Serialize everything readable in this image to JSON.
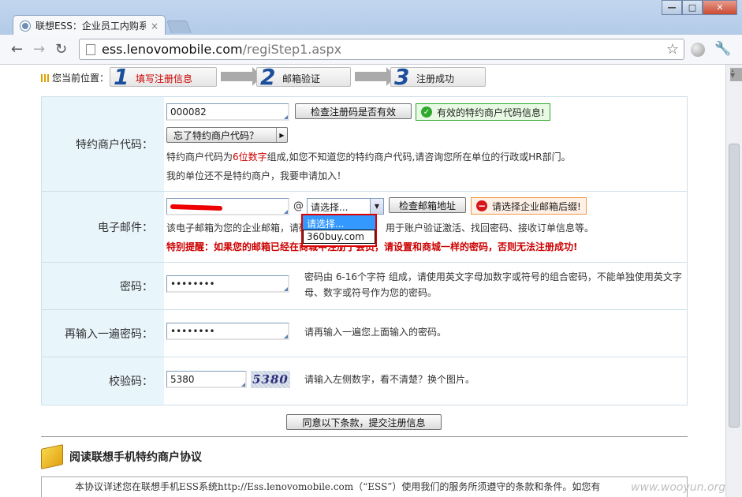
{
  "browser": {
    "tab_title": "联想ESS：企业员工内购系统",
    "tab_close": "×",
    "url_host": "ess.lenovomobile.com",
    "url_path": "/regiStep1.aspx",
    "back": "←",
    "forward": "→",
    "reload": "↻",
    "star": "☆",
    "wrench": "🔧",
    "win_min": "—",
    "win_max": "□",
    "win_close": "✕"
  },
  "breadcrumb": {
    "label": "您当前位置：",
    "steps": [
      {
        "num": "1",
        "label": "填写注册信息"
      },
      {
        "num": "2",
        "label": "邮箱验证"
      },
      {
        "num": "3",
        "label": "注册成功"
      }
    ]
  },
  "merchant": {
    "label": "特约商户代码：",
    "value": "000082",
    "check_button": "检查注册码是否有效",
    "valid_msg": "有效的特约商户代码信息!",
    "forgot_button": "忘了特约商户代码？",
    "hint_pre": "特约商户代码为",
    "hint_digits": "6位数字",
    "hint_post": "组成,如您不知道您的特约商户代码,请咨询您所在单位的行政或HR部门。",
    "apply_text": "我的单位还不是特约商户，我要申请加入！"
  },
  "email": {
    "label": "电子邮件：",
    "at": "@",
    "select_value": "请选择...",
    "options": [
      "请选择...",
      "360buy.com"
    ],
    "check_button": "检查邮箱地址",
    "error_msg": "请选择企业邮箱后缀!",
    "hint_a": "该电子邮箱为您的企业邮箱，请确",
    "hint_b": "用于账户验证激活、找回密码、接收订单信息等。",
    "warning": "特别提醒：如果您的邮箱已经在商城中注册了会员，请设置和商城一样的密码，否则无法注册成功!"
  },
  "password": {
    "label": "密码：",
    "value": "••••••••",
    "hint": "密码由 6-16个字符 组成，请使用英文字母加数字或符号的组合密码，不能单独使用英文字母、数字或符号作为您的密码。"
  },
  "password_confirm": {
    "label": "再输入一遍密码：",
    "value": "••••••••",
    "hint": "请再输入一遍您上面输入的密码。"
  },
  "captcha": {
    "label": "校验码：",
    "value": "5380",
    "image_text": "5380",
    "hint": "请输入左侧数字，看不清楚？换个图片。"
  },
  "submit_button": "同意以下条款，提交注册信息",
  "agreement": {
    "title": "阅读联想手机特约商户协议",
    "text": "本协议详述您在联想手机ESS系统http://Ess.lenovomobile.com（“ESS”）使用我们的服务所须遵守的条款和条件。如您有"
  },
  "watermark": "www.wooyun.org"
}
